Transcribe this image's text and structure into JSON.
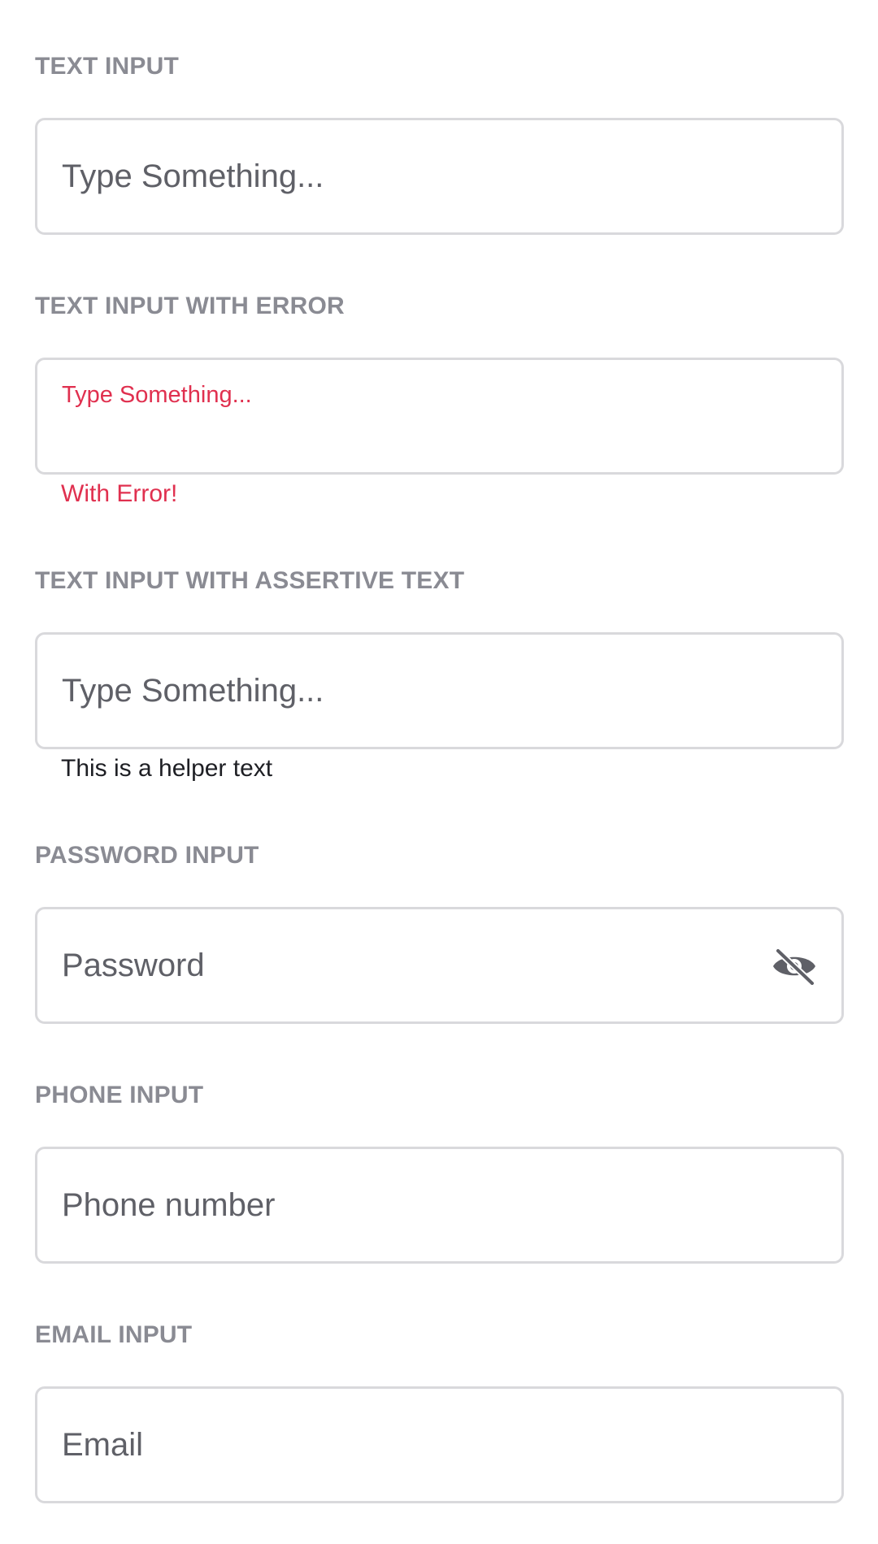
{
  "sections": {
    "text_input": {
      "label": "TEXT INPUT",
      "placeholder": "Type Something..."
    },
    "text_input_error": {
      "label": "TEXT INPUT WITH ERROR",
      "placeholder": "Type Something...",
      "error_text": "With Error!"
    },
    "text_input_assertive": {
      "label": "TEXT INPUT WITH ASSERTIVE TEXT",
      "placeholder": "Type Something...",
      "helper_text": "This is a helper text"
    },
    "password_input": {
      "label": "PASSWORD INPUT",
      "placeholder": "Password",
      "toggle_icon": "eye-off-icon"
    },
    "phone_input": {
      "label": "PHONE INPUT",
      "placeholder": "Phone number"
    },
    "email_input": {
      "label": "EMAIL INPUT",
      "placeholder": "Email"
    }
  },
  "colors": {
    "label": "#8a8b93",
    "border": "#d9d9dc",
    "placeholder": "#5f6067",
    "error": "#e0304f",
    "helper": "#1e1f24"
  }
}
